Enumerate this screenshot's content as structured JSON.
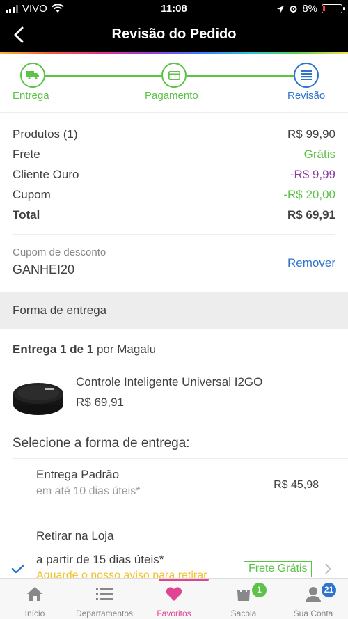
{
  "status_bar": {
    "carrier": "VIVO",
    "time": "11:08",
    "battery": "8%"
  },
  "header": {
    "title": "Revisão do Pedido"
  },
  "stepper": {
    "steps": [
      {
        "label": "Entrega",
        "icon": "truck-icon"
      },
      {
        "label": "Pagamento",
        "icon": "card-icon"
      },
      {
        "label": "Revisão",
        "icon": "document-icon"
      }
    ]
  },
  "summary": {
    "rows": [
      {
        "label": "Produtos (1)",
        "value": "R$ 99,90"
      },
      {
        "label": "Frete",
        "value": "Grátis"
      },
      {
        "label": "Cliente Ouro",
        "value": "-R$ 9,99"
      },
      {
        "label": "Cupom",
        "value": "-R$ 20,00"
      },
      {
        "label": "Total",
        "value": "R$ 69,91"
      }
    ]
  },
  "coupon": {
    "label": "Cupom de desconto",
    "code": "GANHEI20",
    "remove_label": "Remover"
  },
  "delivery_section": {
    "title": "Forma de entrega",
    "delivery_count": "Entrega 1 de 1",
    "seller_prefix": "por",
    "seller": "Magalu"
  },
  "product": {
    "name": "Controle Inteligente Universal I2GO",
    "price": "R$ 69,91"
  },
  "shipping": {
    "title": "Selecione a forma de entrega:",
    "options": [
      {
        "name": "Entrega Padrão",
        "subtitle": "em até 10 dias úteis*",
        "price": "R$ 45,98"
      },
      {
        "name": "Retirar na Loja",
        "subtitle": "a partir de 15 dias úteis*",
        "notice": "Aguarde o nosso aviso para retirar",
        "badge": "Frete Grátis"
      }
    ]
  },
  "bottom_nav": {
    "items": [
      {
        "label": "Início",
        "icon": "home-icon"
      },
      {
        "label": "Departamentos",
        "icon": "list-icon"
      },
      {
        "label": "Favoritos",
        "icon": "heart-icon"
      },
      {
        "label": "Sacola",
        "icon": "bag-icon",
        "badge": "1"
      },
      {
        "label": "Sua Conta",
        "icon": "user-icon",
        "badge": "21"
      }
    ]
  },
  "colors": {
    "green": "#5cc248",
    "blue": "#2e74cc",
    "purple": "#8a3fa0",
    "pink": "#e04593"
  }
}
